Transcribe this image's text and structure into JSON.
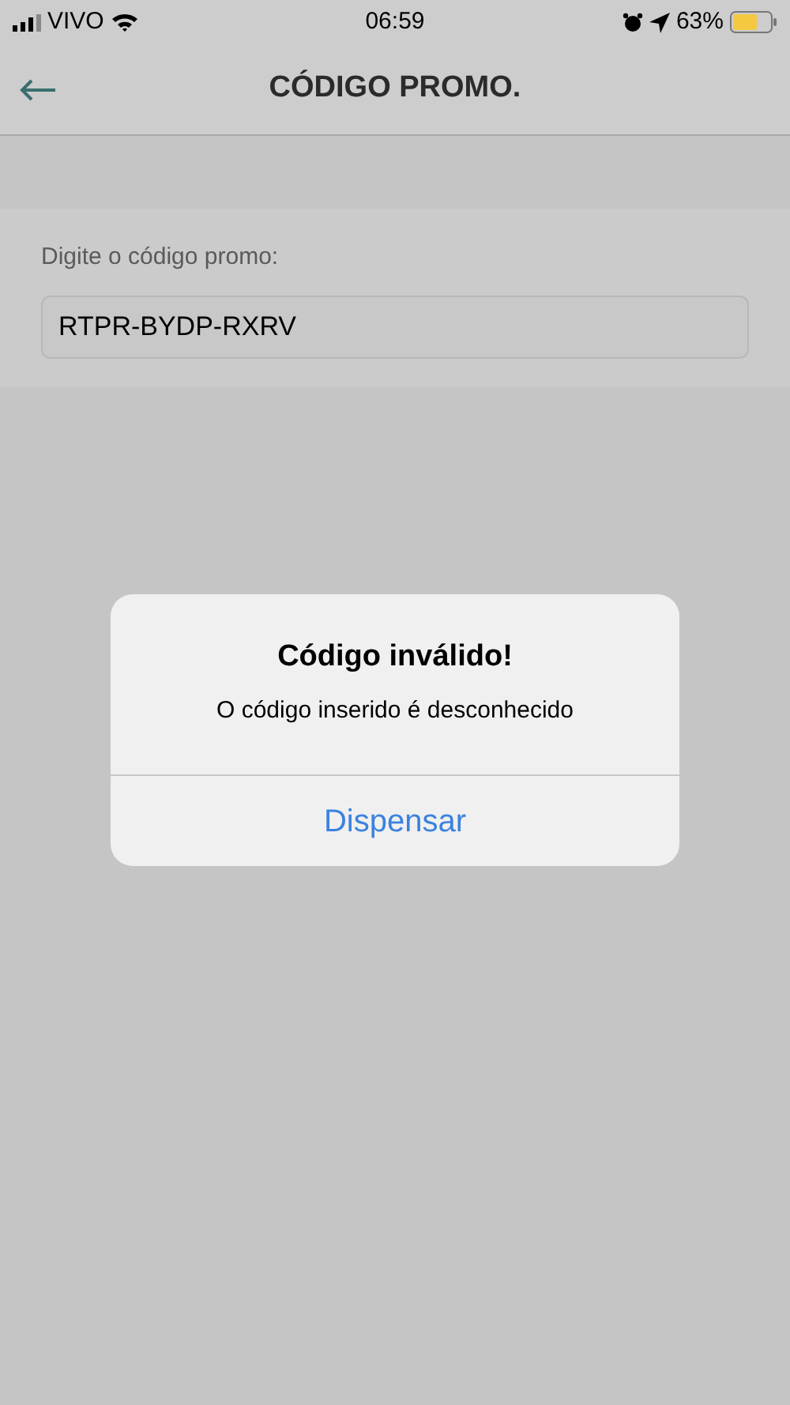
{
  "status_bar": {
    "carrier": "VIVO",
    "time": "06:59",
    "battery": "63%"
  },
  "header": {
    "title": "CÓDIGO PROMO."
  },
  "form": {
    "label": "Digite o código promo:",
    "value": "RTPR-BYDP-RXRV"
  },
  "alert": {
    "title": "Código inválido!",
    "message": "O código inserido é desconhecido",
    "buttons": [
      "Dispensar"
    ]
  }
}
